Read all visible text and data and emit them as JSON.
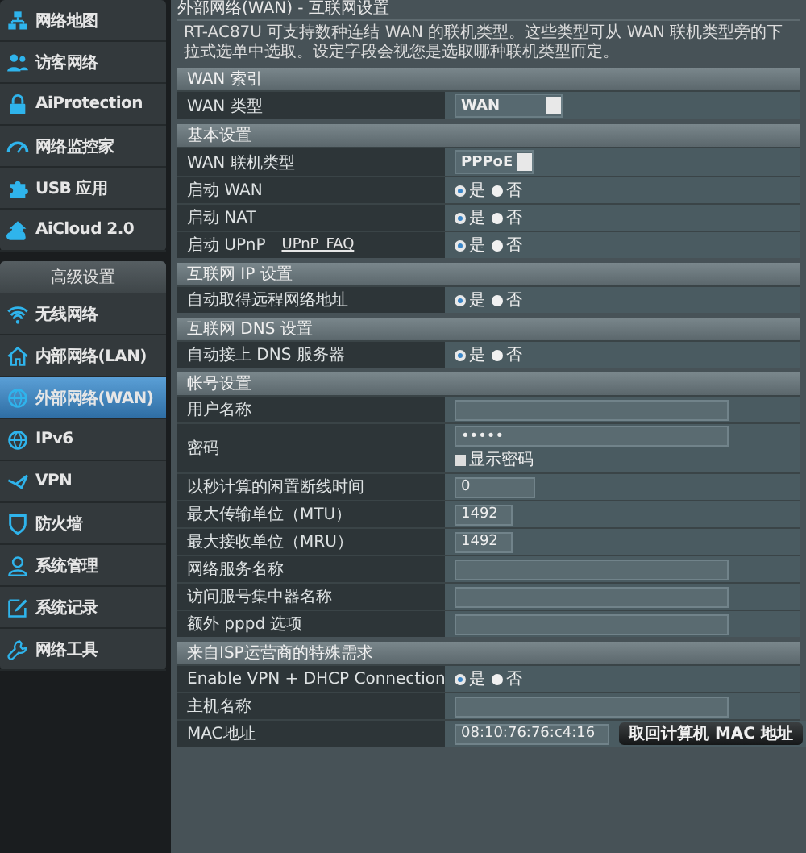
{
  "sidebar": {
    "items": [
      {
        "label": "网络地图",
        "selected": false
      },
      {
        "label": "访客网络",
        "selected": false
      },
      {
        "label": "AiProtection",
        "selected": false
      },
      {
        "label": "网络监控家",
        "selected": false
      },
      {
        "label": "USB 应用",
        "selected": false
      },
      {
        "label": "AiCloud 2.0",
        "selected": false
      }
    ],
    "section_title": "高级设置",
    "advanced_items": [
      {
        "label": "无线网络",
        "selected": false
      },
      {
        "label": "内部网络(LAN)",
        "selected": false
      },
      {
        "label": "外部网络(WAN)",
        "selected": true
      },
      {
        "label": "IPv6",
        "selected": false
      },
      {
        "label": "VPN",
        "selected": false
      },
      {
        "label": "防火墙",
        "selected": false
      },
      {
        "label": "系统管理",
        "selected": false
      },
      {
        "label": "系统记录",
        "selected": false
      },
      {
        "label": "网络工具",
        "selected": false
      }
    ]
  },
  "page": {
    "title": "外部网络(WAN) - 互联网设置",
    "description": "RT-AC87U 可支持数种连结 WAN 的联机类型。这些类型可从 WAN 联机类型旁的下拉式选单中选取。设定字段会视您是选取哪种联机类型而定。",
    "sections": [
      {
        "title": "WAN 索引",
        "rows": [
          {
            "kind": "select",
            "label": "WAN 类型",
            "value": "WAN"
          }
        ]
      },
      {
        "title": "基本设置",
        "rows": [
          {
            "kind": "select",
            "label": "WAN 联机类型",
            "value": "PPPoE"
          },
          {
            "kind": "radio",
            "label": "启动 WAN",
            "options": [
              {
                "label": "是",
                "selected": true
              },
              {
                "label": "否",
                "selected": false
              }
            ]
          },
          {
            "kind": "radio",
            "label": "启动 NAT",
            "options": [
              {
                "label": "是",
                "selected": true
              },
              {
                "label": "否",
                "selected": false
              }
            ]
          },
          {
            "kind": "radio",
            "label": "启动 UPnP",
            "link": "UPnP_FAQ",
            "options": [
              {
                "label": "是",
                "selected": true
              },
              {
                "label": "否",
                "selected": false
              }
            ]
          }
        ]
      },
      {
        "title": "互联网 IP 设置",
        "rows": [
          {
            "kind": "radio",
            "label": "自动取得远程网络地址",
            "options": [
              {
                "label": "是",
                "selected": true
              },
              {
                "label": "否",
                "selected": false
              }
            ]
          }
        ]
      },
      {
        "title": "互联网 DNS 设置",
        "rows": [
          {
            "kind": "radio",
            "label": "自动接上 DNS 服务器",
            "options": [
              {
                "label": "是",
                "selected": true
              },
              {
                "label": "否",
                "selected": false
              }
            ]
          }
        ]
      },
      {
        "title": "帐号设置",
        "rows": [
          {
            "kind": "input",
            "label": "用户名称"
          },
          {
            "kind": "password",
            "label": "密码",
            "value": "•••••",
            "checkbox": {
              "label": "显示密码",
              "checked": false
            }
          },
          {
            "kind": "medium_input",
            "label": "以秒计算的闲置断线时间",
            "value": "0"
          },
          {
            "kind": "short_input",
            "label": "最大传输单位（MTU）",
            "value": "1492"
          },
          {
            "kind": "short_input",
            "label": "最大接收单位（MRU）",
            "value": "1492"
          },
          {
            "kind": "input",
            "label": "网络服务名称"
          },
          {
            "kind": "input",
            "label": "访问服号集中器名称"
          },
          {
            "kind": "input",
            "label": "额外 pppd 选项"
          }
        ]
      },
      {
        "title": "来自ISP运营商的特殊需求",
        "rows": [
          {
            "kind": "radio",
            "label": "Enable VPN + DHCP Connection",
            "options": [
              {
                "label": "是",
                "selected": true
              },
              {
                "label": "否",
                "selected": false
              }
            ]
          },
          {
            "kind": "input",
            "label": "主机名称"
          },
          {
            "kind": "mac",
            "label": "MAC地址",
            "value": "08:10:76:76:c4:16",
            "button": "取回计算机 MAC 地址"
          }
        ]
      }
    ]
  }
}
